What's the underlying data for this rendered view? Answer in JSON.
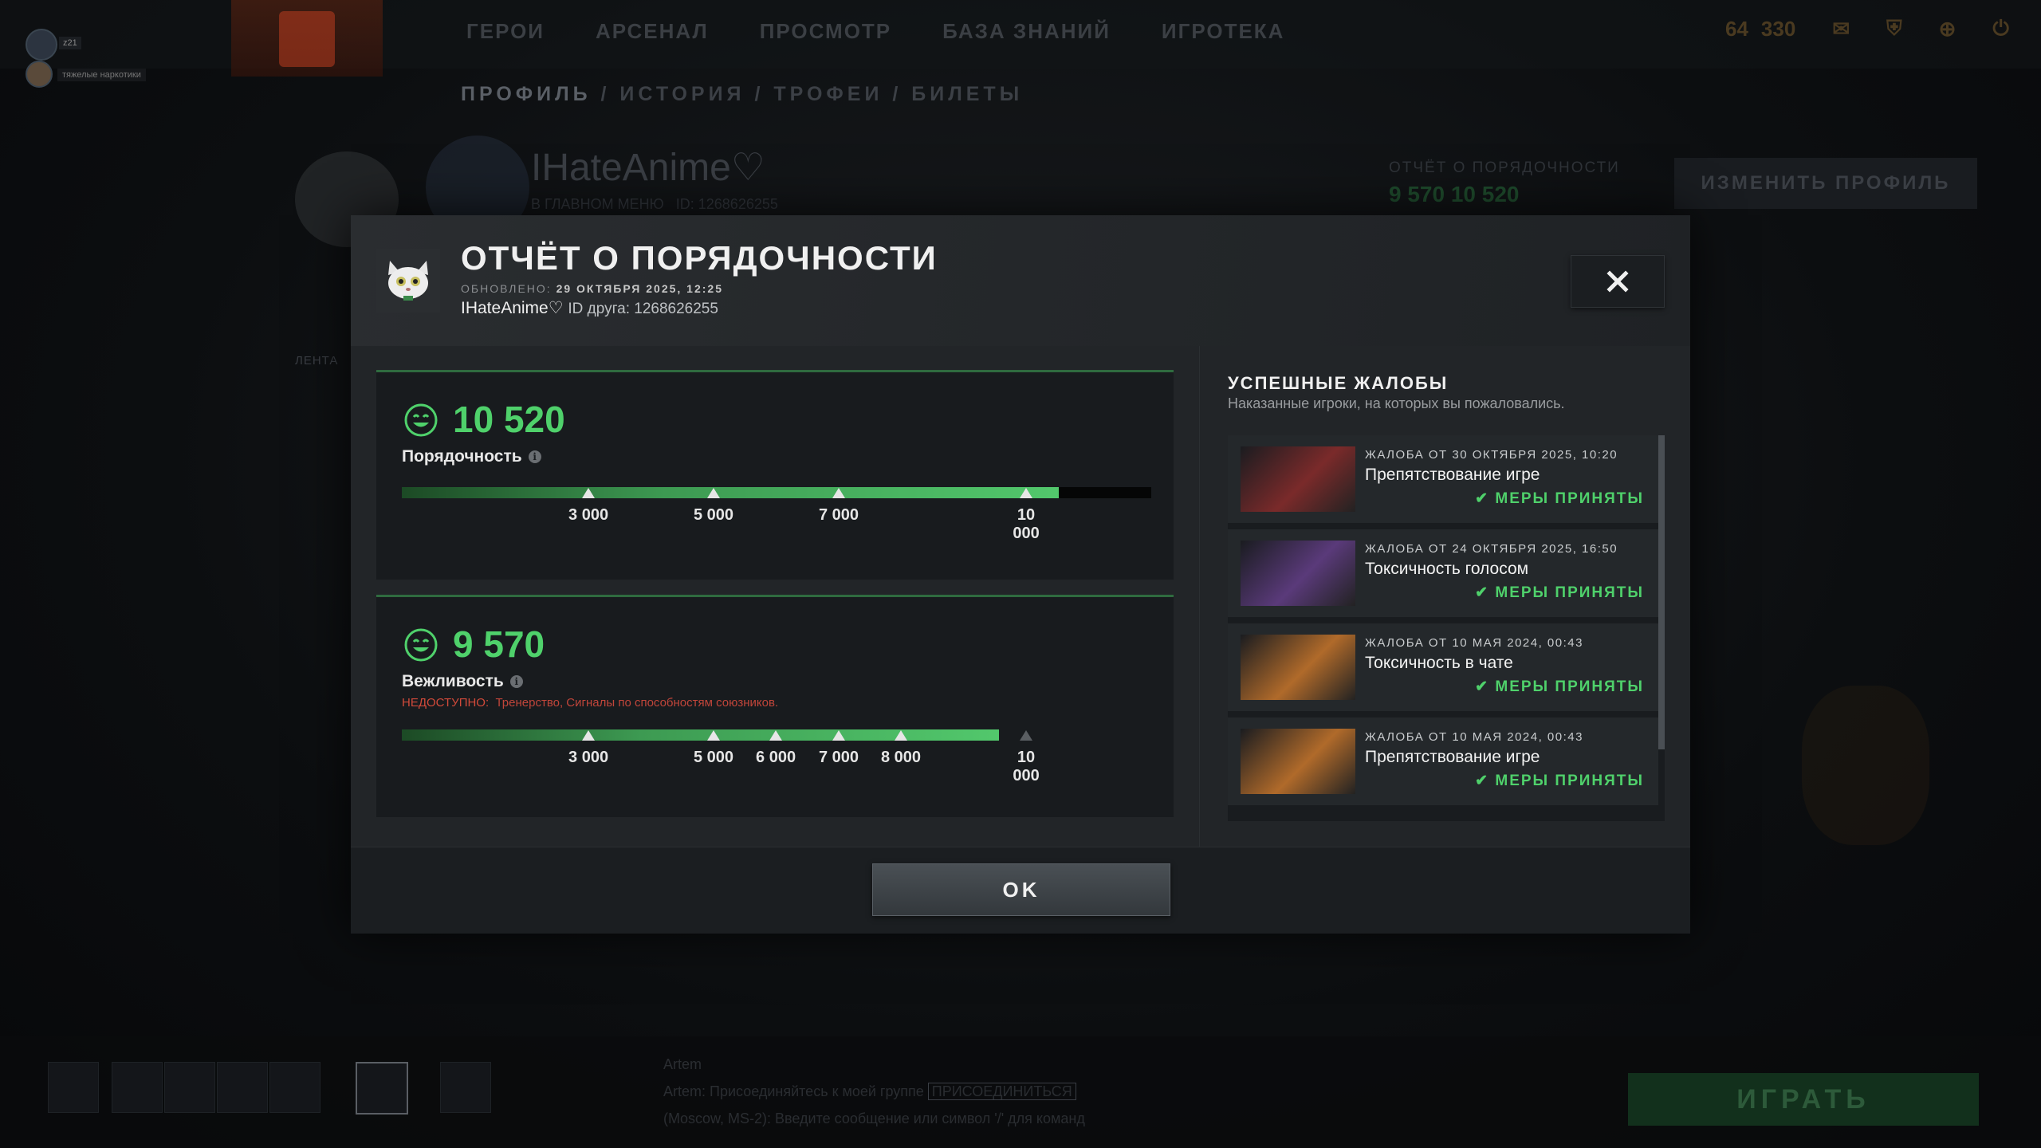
{
  "background": {
    "nav": [
      "ГЕРОИ",
      "АРСЕНАЛ",
      "ПРОСМОТР",
      "БАЗА ЗНАНИЙ",
      "ИГРОТЕКА"
    ],
    "currency_a": "64",
    "currency_b": "330",
    "party_level": "z21",
    "party_name": "тяжелые наркотики",
    "breadcrumbs": [
      "ПРОФИЛЬ",
      "ИСТОРИЯ",
      "ТРОФЕИ",
      "БИЛЕТЫ"
    ],
    "profile_name": "IHateAnime♡",
    "profile_sub": "В ГЛАВНОМ МЕНЮ",
    "profile_id": "ID: 1268626255",
    "report_label": "ОТЧЁТ О ПОРЯДОЧНОСТИ",
    "report_values": "9 570   10 520",
    "edit_profile": "ИЗМЕНИТЬ ПРОФИЛЬ",
    "feed_label": "ЛЕНТА",
    "chat_line1_name": "Artem",
    "chat_line1": "Artem: Присоединяйтесь к моей группе",
    "chat_join": "ПРИСОЕДИНИТЬСЯ",
    "chat_line2": "(Moscow, MS-2): Введите сообщение или символ '/' для команд",
    "play_label": "ИГРАТЬ"
  },
  "modal": {
    "title": "ОТЧЁТ О ПОРЯДОЧНОСТИ",
    "updated_label": "ОБНОВЛЕНО:",
    "updated_value": "29 ОКТЯБРЯ 2025, 12:25",
    "player_name": "IHateAnime♡",
    "friend_id": "ID друга: 1268626255",
    "close_icon": "close-icon",
    "ok_label": "OK"
  },
  "behavior": {
    "value": "10 520",
    "label": "Порядочность",
    "fill_fraction": 0.877,
    "ticks": [
      {
        "label": "3 000",
        "pos": 0.249
      },
      {
        "label": "5 000",
        "pos": 0.416
      },
      {
        "label": "7 000",
        "pos": 0.583
      },
      {
        "label": "10\n000",
        "pos": 0.833
      }
    ]
  },
  "communication": {
    "value": "9 570",
    "label": "Вежливость",
    "unavailable_label": "НЕДОСТУПНО:",
    "unavailable_reason": "Тренерство, Сигналы по способностям союзников.",
    "fill_fraction": 0.797,
    "ticks": [
      {
        "label": "3 000",
        "pos": 0.249,
        "dim": false
      },
      {
        "label": "5 000",
        "pos": 0.416,
        "dim": false
      },
      {
        "label": "6 000",
        "pos": 0.499,
        "dim": false
      },
      {
        "label": "7 000",
        "pos": 0.583,
        "dim": false
      },
      {
        "label": "8 000",
        "pos": 0.666,
        "dim": false
      },
      {
        "label": "10\n000",
        "pos": 0.833,
        "dim": true
      }
    ]
  },
  "reports": {
    "title": "УСПЕШНЫЕ ЖАЛОБЫ",
    "subtitle": "Наказанные игроки, на которых вы пожаловались.",
    "items": [
      {
        "date": "ЖАЛОБА ОТ 30 ОКТЯБРЯ 2025, 10:20",
        "reason": "Препятствование игре",
        "status": "МЕРЫ ПРИНЯТЫ",
        "hero_color": "#7a2a2a"
      },
      {
        "date": "ЖАЛОБА ОТ 24 ОКТЯБРЯ 2025, 16:50",
        "reason": "Токсичность голосом",
        "status": "МЕРЫ ПРИНЯТЫ",
        "hero_color": "#5a3a7a"
      },
      {
        "date": "ЖАЛОБА ОТ 10 МАЯ 2024, 00:43",
        "reason": "Токсичность в чате",
        "status": "МЕРЫ ПРИНЯТЫ",
        "hero_color": "#b06a2a"
      },
      {
        "date": "ЖАЛОБА ОТ 10 МАЯ 2024, 00:43",
        "reason": "Препятствование игре",
        "status": "МЕРЫ ПРИНЯТЫ",
        "hero_color": "#b06a2a"
      }
    ]
  },
  "colors": {
    "accent_green": "#4fd16b",
    "warning_red": "#d24a3a"
  }
}
